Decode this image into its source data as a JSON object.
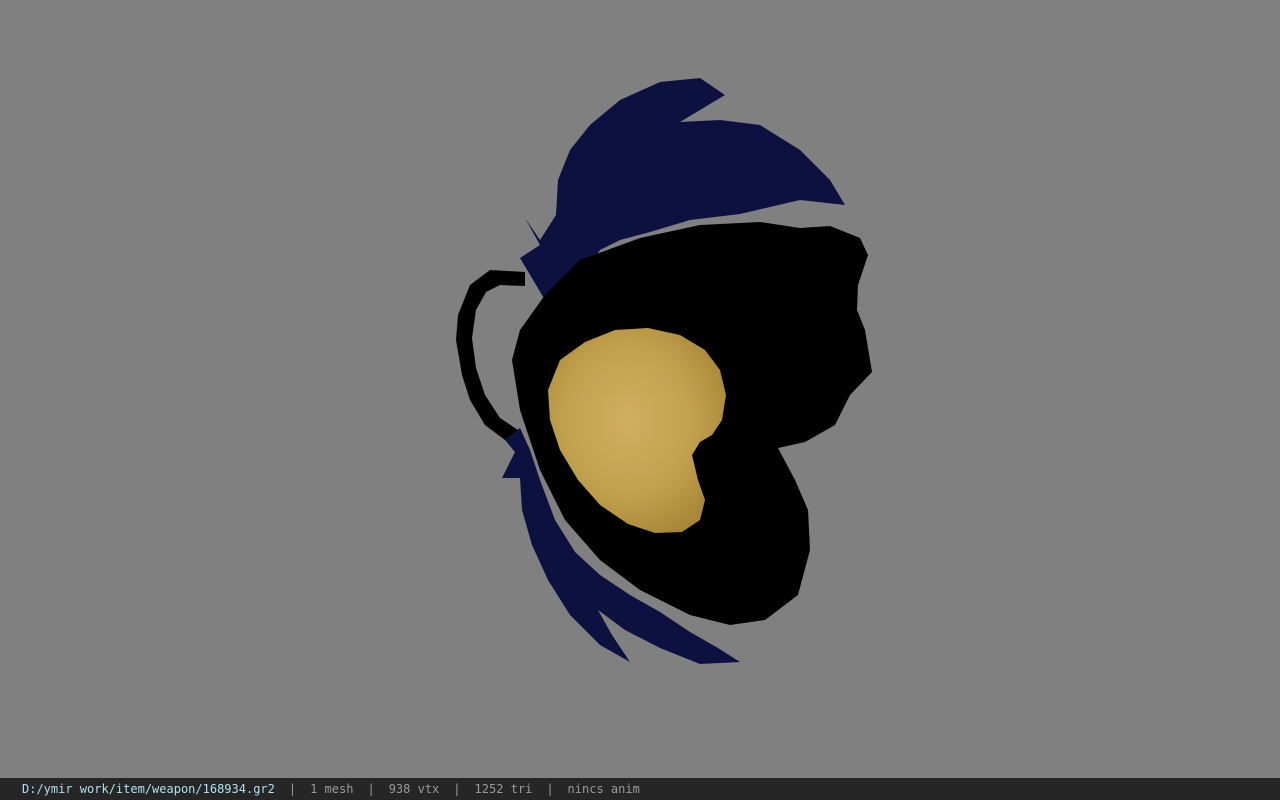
{
  "viewer": {
    "background_color": "#808080",
    "model": {
      "icon": "heart-shield-weapon-model",
      "colors": {
        "body": "#000000",
        "feathers": "#0d1140",
        "inlay": "#c9a752"
      }
    }
  },
  "status_bar": {
    "file_path": "D:/ymir work/item/weapon/168934.gr2",
    "mesh_count": "1 mesh",
    "vertex_count": "938 vtx",
    "triangle_count": "1252 tri",
    "animation": "nincs anim",
    "separator": "|"
  }
}
